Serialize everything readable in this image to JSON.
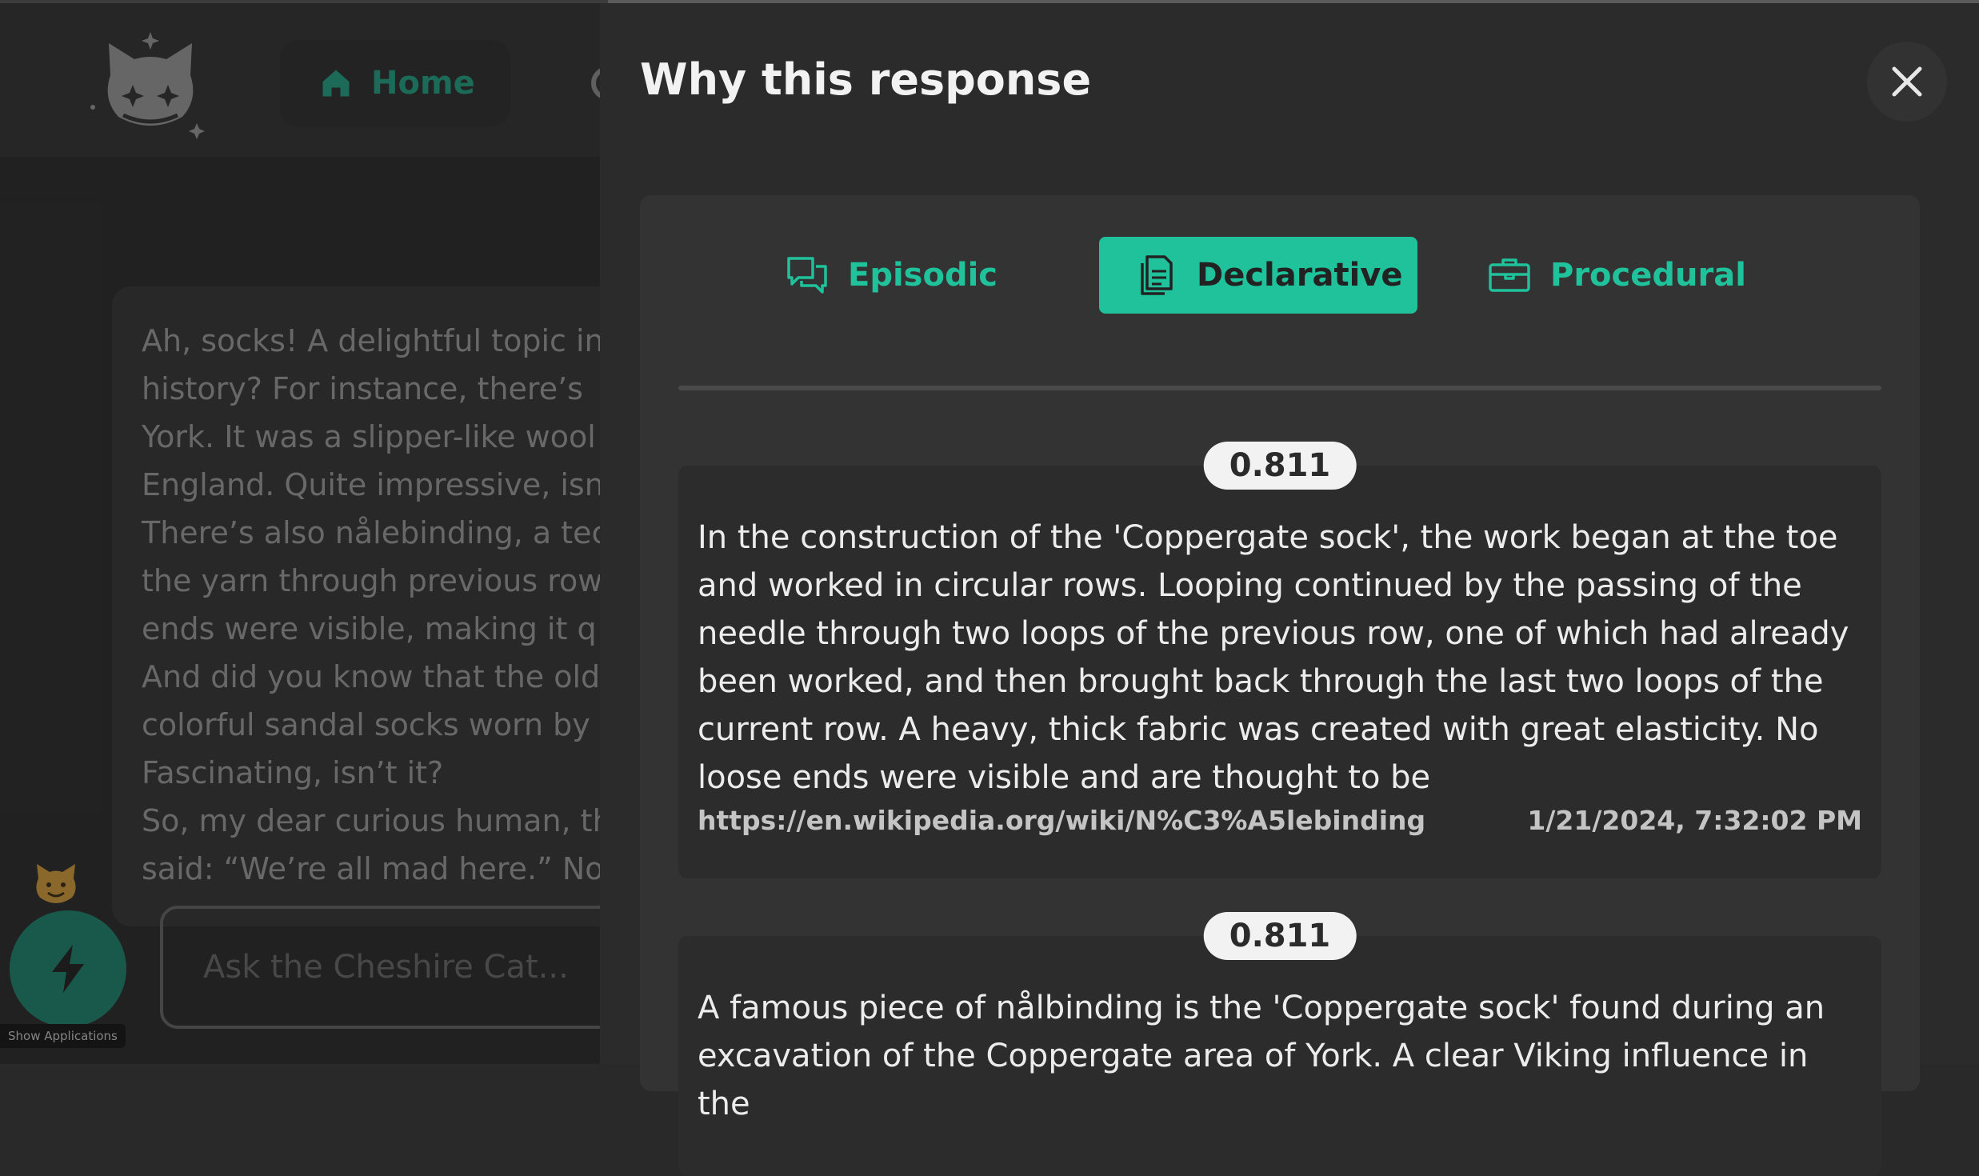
{
  "nav": {
    "home_label": "Home"
  },
  "chat": {
    "message_lines": [
      "Ah, socks! A delightful topic in",
      "history? For instance, there’s",
      "York. It was a slipper-like wool",
      "England. Quite impressive, isn",
      "There’s also nålebinding, a tec",
      "the yarn through previous row",
      "ends were visible, making it q",
      "And did you know that the old",
      "colorful sandal socks worn by",
      "Fascinating, isn’t it?",
      "So, my dear curious human, th",
      "said: “We’re all mad here.” Now"
    ],
    "input_placeholder": "Ask the Cheshire Cat...",
    "apps_label": "Show Applications"
  },
  "panel": {
    "title": "Why this response",
    "tabs": [
      {
        "label": "Episodic",
        "icon": "chat-bubbles-icon"
      },
      {
        "label": "Declarative",
        "icon": "documents-icon",
        "active": true
      },
      {
        "label": "Procedural",
        "icon": "briefcase-icon"
      }
    ],
    "results": [
      {
        "score": "0.811",
        "text": "In the construction of the 'Coppergate sock', the work began at the toe and worked in circular rows. Looping continued by the passing of the needle through two loops of the previous row, one of which had already been worked, and then brought back through the last two loops of the current row. A heavy, thick fabric was created with great elasticity. No loose ends were visible and are thought to be",
        "source": "https://en.wikipedia.org/wiki/N%C3%A5lebinding",
        "date": "1/21/2024, 7:32:02 PM"
      },
      {
        "score": "0.811",
        "text": "A famous piece of nålbinding is the 'Coppergate sock' found during an excavation of the Coppergate area of York. A clear Viking influence in the"
      }
    ]
  },
  "colors": {
    "accent": "#1fc29b",
    "background": "#292929",
    "panel": "#2b2b2b"
  }
}
